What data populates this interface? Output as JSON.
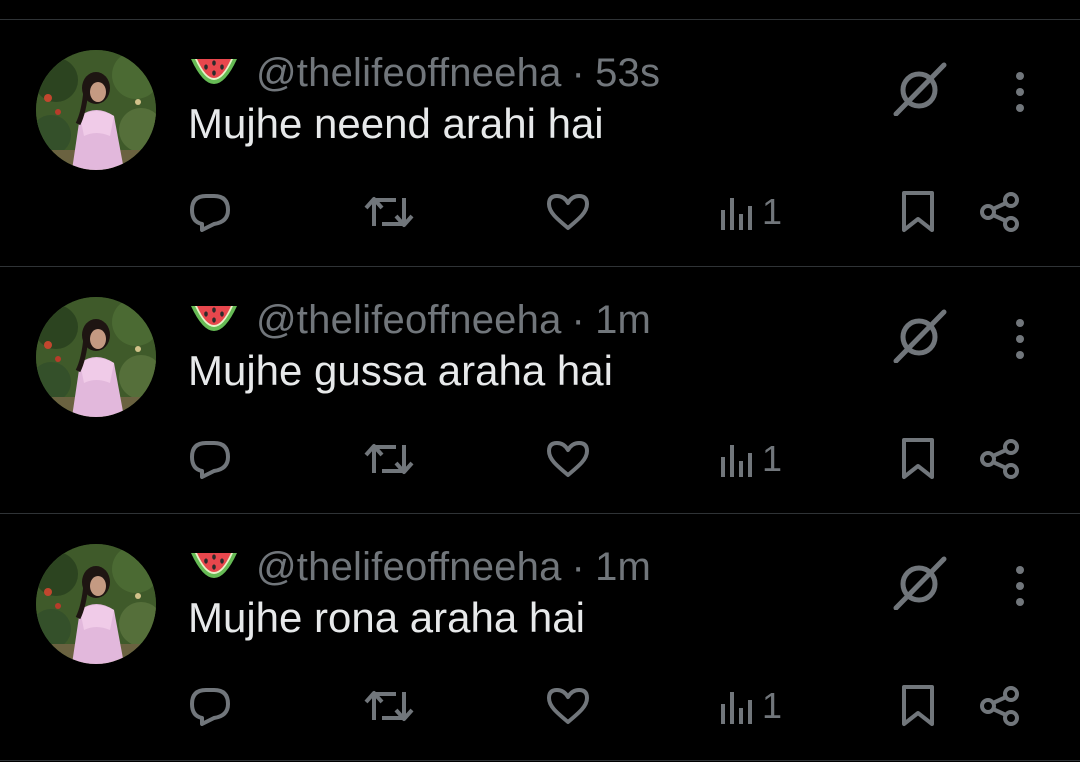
{
  "colors": {
    "background": "#000000",
    "text_primary": "#e7e9ea",
    "text_secondary": "#71767b",
    "divider": "#2f3336"
  },
  "tweets": [
    {
      "emoji": "watermelon",
      "handle": "@thelifeoffneeha",
      "separator": "·",
      "time": "53s",
      "text": "Mujhe neend arahi hai",
      "views": "1"
    },
    {
      "emoji": "watermelon",
      "handle": "@thelifeoffneeha",
      "separator": "·",
      "time": "1m",
      "text": "Mujhe gussa araha hai",
      "views": "1"
    },
    {
      "emoji": "watermelon",
      "handle": "@thelifeoffneeha",
      "separator": "·",
      "time": "1m",
      "text": "Mujhe rona araha hai",
      "views": "1"
    }
  ],
  "icons": {
    "reply": "reply-bubble-icon",
    "repost": "repost-arrows-icon",
    "like": "heart-icon",
    "views": "bar-chart-icon",
    "bookmark": "bookmark-icon",
    "share": "share-nodes-icon",
    "grok": "grok-slash-icon",
    "more": "vertical-dots-icon"
  }
}
